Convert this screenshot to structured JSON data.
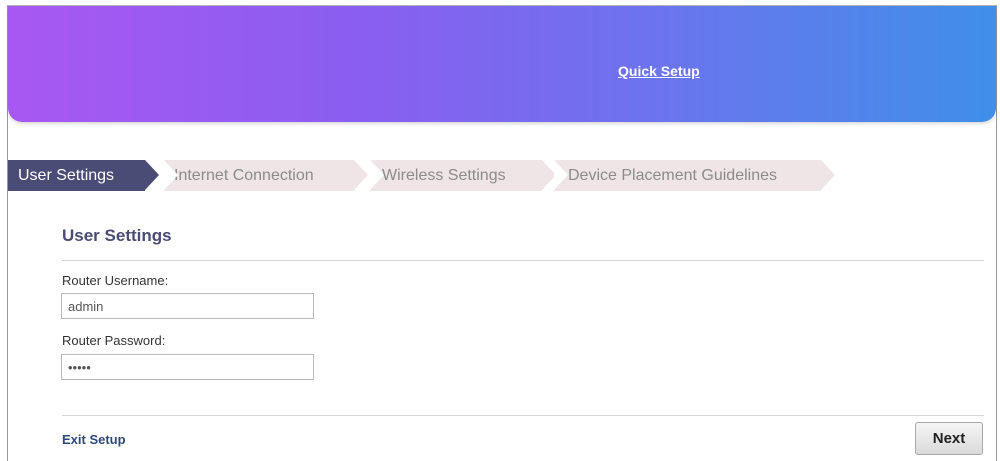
{
  "header": {
    "title": "Quick Setup"
  },
  "wizard": {
    "steps": [
      {
        "label": "User Settings",
        "active": true
      },
      {
        "label": "Internet Connection",
        "active": false
      },
      {
        "label": "Wireless Settings",
        "active": false
      },
      {
        "label": "Device Placement Guidelines",
        "active": false
      }
    ]
  },
  "form": {
    "section_title": "User Settings",
    "username_label": "Router Username:",
    "username_value": "admin",
    "password_label": "Router Password:",
    "password_value": "•••••"
  },
  "footer": {
    "exit_label": "Exit Setup",
    "next_label": "Next"
  },
  "colors": {
    "header_gradient_start": "#a858f2",
    "header_gradient_end": "#3f8fe8",
    "active_step": "#4a4c75",
    "inactive_step": "#efe5e7"
  }
}
